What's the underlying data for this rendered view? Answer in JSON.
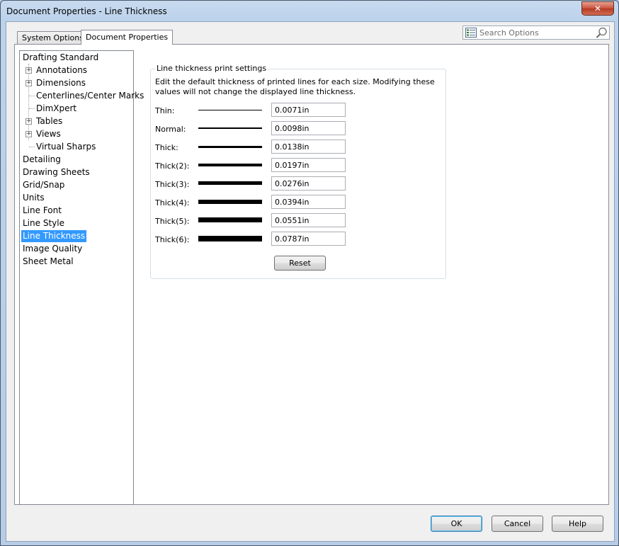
{
  "window": {
    "title": "Document Properties - Line Thickness",
    "close_glyph": "✕"
  },
  "tabs": [
    {
      "label": "System Options",
      "active": false
    },
    {
      "label": "Document Properties",
      "active": true
    }
  ],
  "search": {
    "placeholder": "Search Options",
    "icon": "list-icon",
    "search_icon": "magnifier-icon"
  },
  "tree": {
    "items": [
      {
        "label": "Drafting Standard",
        "level": 0
      },
      {
        "label": "Annotations",
        "level": 1,
        "expander": "+"
      },
      {
        "label": "Dimensions",
        "level": 1,
        "expander": "+"
      },
      {
        "label": "Centerlines/Center Marks",
        "level": 1
      },
      {
        "label": "DimXpert",
        "level": 1
      },
      {
        "label": "Tables",
        "level": 1,
        "expander": "+"
      },
      {
        "label": "Views",
        "level": 1,
        "expander": "+"
      },
      {
        "label": "Virtual Sharps",
        "level": 1
      },
      {
        "label": "Detailing",
        "level": 0
      },
      {
        "label": "Drawing Sheets",
        "level": 0
      },
      {
        "label": "Grid/Snap",
        "level": 0
      },
      {
        "label": "Units",
        "level": 0
      },
      {
        "label": "Line Font",
        "level": 0
      },
      {
        "label": "Line Style",
        "level": 0
      },
      {
        "label": "Line Thickness",
        "level": 0,
        "selected": true
      },
      {
        "label": "Image Quality",
        "level": 0
      },
      {
        "label": "Sheet Metal",
        "level": 0
      }
    ],
    "selection_color": "#3399ff"
  },
  "group": {
    "legend": "Line thickness print settings",
    "description": "Edit the default thickness of printed lines for each size.  Modifying these values will not change the displayed line thickness.",
    "rows": [
      {
        "label": "Thin:",
        "value": "0.0071in"
      },
      {
        "label": "Normal:",
        "value": "0.0098in"
      },
      {
        "label": "Thick:",
        "value": "0.0138in"
      },
      {
        "label": "Thick(2):",
        "value": "0.0197in"
      },
      {
        "label": "Thick(3):",
        "value": "0.0276in"
      },
      {
        "label": "Thick(4):",
        "value": "0.0394in"
      },
      {
        "label": "Thick(5):",
        "value": "0.0551in"
      },
      {
        "label": "Thick(6):",
        "value": "0.0787in"
      }
    ],
    "reset_label": "Reset"
  },
  "footer": {
    "ok_label": "OK",
    "cancel_label": "Cancel",
    "help_label": "Help"
  }
}
